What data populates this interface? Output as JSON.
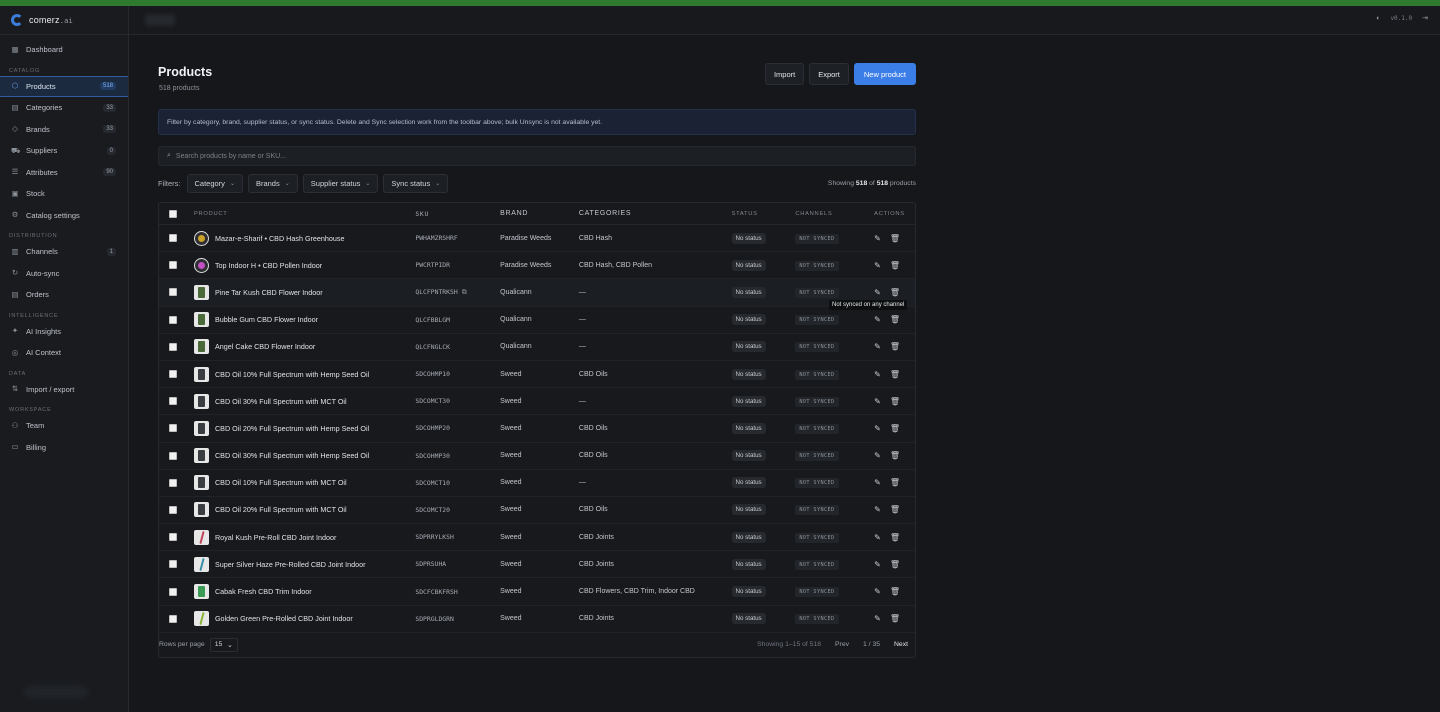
{
  "app": {
    "logo_name": "comerz",
    "logo_suffix": ".ai",
    "version": "v0.1.0"
  },
  "sidebar": {
    "dashboard": {
      "label": "Dashboard",
      "icon": "dashboard-icon"
    },
    "sections": [
      {
        "title": "CATALOG",
        "items": [
          {
            "label": "Products",
            "badge": "518",
            "icon": "box-icon",
            "active": true
          },
          {
            "label": "Categories",
            "badge": "33",
            "icon": "categories-icon"
          },
          {
            "label": "Brands",
            "badge": "33",
            "icon": "tag-icon"
          },
          {
            "label": "Suppliers",
            "badge": "0",
            "icon": "truck-icon"
          },
          {
            "label": "Attributes",
            "badge": "90",
            "icon": "list-icon"
          },
          {
            "label": "Stock",
            "badge": "",
            "icon": "stock-icon"
          },
          {
            "label": "Catalog settings",
            "badge": "",
            "icon": "gear-icon"
          }
        ]
      },
      {
        "title": "DISTRIBUTION",
        "items": [
          {
            "label": "Channels",
            "badge": "1",
            "icon": "channels-icon"
          },
          {
            "label": "Auto-sync",
            "badge": "",
            "icon": "sync-icon"
          },
          {
            "label": "Orders",
            "badge": "",
            "icon": "orders-icon"
          }
        ]
      },
      {
        "title": "INTELLIGENCE",
        "items": [
          {
            "label": "AI Insights",
            "badge": "",
            "icon": "sparkle-icon"
          },
          {
            "label": "AI Context",
            "badge": "",
            "icon": "context-icon"
          }
        ]
      },
      {
        "title": "DATA",
        "items": [
          {
            "label": "Import / export",
            "badge": "",
            "icon": "import-export-icon"
          }
        ]
      },
      {
        "title": "WORKSPACE",
        "items": [
          {
            "label": "Team",
            "badge": "",
            "icon": "team-icon"
          },
          {
            "label": "Billing",
            "badge": "",
            "icon": "billing-icon"
          }
        ]
      }
    ]
  },
  "page": {
    "title": "Products",
    "subtitle": "518 products",
    "import_label": "Import",
    "export_label": "Export",
    "new_label": "New product",
    "info": "Filter by category, brand, supplier status, or sync status. Delete and Sync selection work from the toolbar above; bulk Unsync is not available yet.",
    "search_placeholder": "Search products by name or SKU...",
    "filters_label": "Filters:",
    "filters": [
      "Category",
      "Brands",
      "Supplier status",
      "Sync status"
    ],
    "showing_pre": "Showing",
    "showing_count": "518",
    "showing_mid": "of",
    "showing_total": "518",
    "showing_post": "products"
  },
  "table": {
    "columns": [
      "PRODUCT",
      "SKU",
      "BRAND",
      "CATEGORIES",
      "STATUS",
      "CHANNELS",
      "ACTIONS"
    ],
    "rows": [
      {
        "name": "Mazar-e-Sharif • CBD Hash Greenhouse",
        "sku": "PWHAMZRSHRF",
        "brand": "Paradise Weeds",
        "categories": "CBD Hash",
        "status": "No status",
        "channel": "NOT SYNCED",
        "thumb": "round",
        "color": "#c9a227"
      },
      {
        "name": "Top Indoor H • CBD Pollen Indoor",
        "sku": "PWCRTPIDR",
        "brand": "Paradise Weeds",
        "categories": "CBD Hash, CBD Pollen",
        "status": "No status",
        "channel": "NOT SYNCED",
        "thumb": "round",
        "color": "#c44fc4"
      },
      {
        "name": "Pine Tar Kush CBD Flower Indoor",
        "sku": "QLCFPNTRKSH",
        "brand": "Qualicann",
        "categories": "—",
        "status": "No status",
        "channel": "NOT SYNCED",
        "thumb": "jar",
        "color": "#4a6a3a"
      },
      {
        "name": "Bubble Gum CBD Flower Indoor",
        "sku": "QLCFBBLGM",
        "brand": "Qualicann",
        "categories": "—",
        "status": "No status",
        "channel": "NOT SYNCED",
        "thumb": "jar",
        "color": "#4a6a3a"
      },
      {
        "name": "Angel Cake CBD Flower Indoor",
        "sku": "QLCFNGLCK",
        "brand": "Qualicann",
        "categories": "—",
        "status": "No status",
        "channel": "NOT SYNCED",
        "thumb": "jar",
        "color": "#4a6a3a"
      },
      {
        "name": "CBD Oil 10% Full Spectrum with Hemp Seed Oil",
        "sku": "SDCOHMP10",
        "brand": "Sweed",
        "categories": "CBD Oils",
        "status": "No status",
        "channel": "NOT SYNCED",
        "thumb": "bottle",
        "color": "#3a3d42"
      },
      {
        "name": "CBD Oil 30% Full Spectrum with MCT Oil",
        "sku": "SDCOMCT30",
        "brand": "Sweed",
        "categories": "—",
        "status": "No status",
        "channel": "NOT SYNCED",
        "thumb": "bottle",
        "color": "#3a3d42"
      },
      {
        "name": "CBD Oil 20% Full Spectrum with Hemp Seed Oil",
        "sku": "SDCOHMP20",
        "brand": "Sweed",
        "categories": "CBD Oils",
        "status": "No status",
        "channel": "NOT SYNCED",
        "thumb": "bottle",
        "color": "#3a3d42"
      },
      {
        "name": "CBD Oil 30% Full Spectrum with Hemp Seed Oil",
        "sku": "SDCOHMP30",
        "brand": "Sweed",
        "categories": "CBD Oils",
        "status": "No status",
        "channel": "NOT SYNCED",
        "thumb": "bottle",
        "color": "#3a3d42"
      },
      {
        "name": "CBD Oil 10% Full Spectrum with MCT Oil",
        "sku": "SDCOMCT10",
        "brand": "Sweed",
        "categories": "—",
        "status": "No status",
        "channel": "NOT SYNCED",
        "thumb": "bottle",
        "color": "#3a3d42"
      },
      {
        "name": "CBD Oil 20% Full Spectrum with MCT Oil",
        "sku": "SDCOMCT20",
        "brand": "Sweed",
        "categories": "CBD Oils",
        "status": "No status",
        "channel": "NOT SYNCED",
        "thumb": "bottle",
        "color": "#3a3d42"
      },
      {
        "name": "Royal Kush Pre-Roll CBD Joint Indoor",
        "sku": "SDPRRYLKSH",
        "brand": "Sweed",
        "categories": "CBD Joints",
        "status": "No status",
        "channel": "NOT SYNCED",
        "thumb": "joint",
        "color": "#c0445a"
      },
      {
        "name": "Super Silver Haze Pre-Rolled CBD Joint Indoor",
        "sku": "SDPRSUHA",
        "brand": "Sweed",
        "categories": "CBD Joints",
        "status": "No status",
        "channel": "NOT SYNCED",
        "thumb": "joint",
        "color": "#3a8fa8"
      },
      {
        "name": "Cabak Fresh CBD Trim Indoor",
        "sku": "SDCFCBKFRSH",
        "brand": "Sweed",
        "categories": "CBD Flowers, CBD Trim, Indoor CBD",
        "status": "No status",
        "channel": "NOT SYNCED",
        "thumb": "jar",
        "color": "#3b9b56"
      },
      {
        "name": "Golden Green Pre-Rolled CBD Joint Indoor",
        "sku": "SDPRGLDGRN",
        "brand": "Sweed",
        "categories": "CBD Joints",
        "status": "No status",
        "channel": "NOT SYNCED",
        "thumb": "joint",
        "color": "#8bb33a"
      }
    ],
    "tooltip": "Not synced on any channel",
    "footer": {
      "rows_per_page_label": "Rows per page",
      "rows_per_page": "15",
      "range": "Showing 1–15 of 518",
      "prev": "Prev",
      "page": "1 / 35",
      "next": "Next"
    }
  },
  "colors": {
    "accent": "#3b7ee8",
    "bg": "#15171b",
    "active_nav": "#1c2a3f"
  }
}
